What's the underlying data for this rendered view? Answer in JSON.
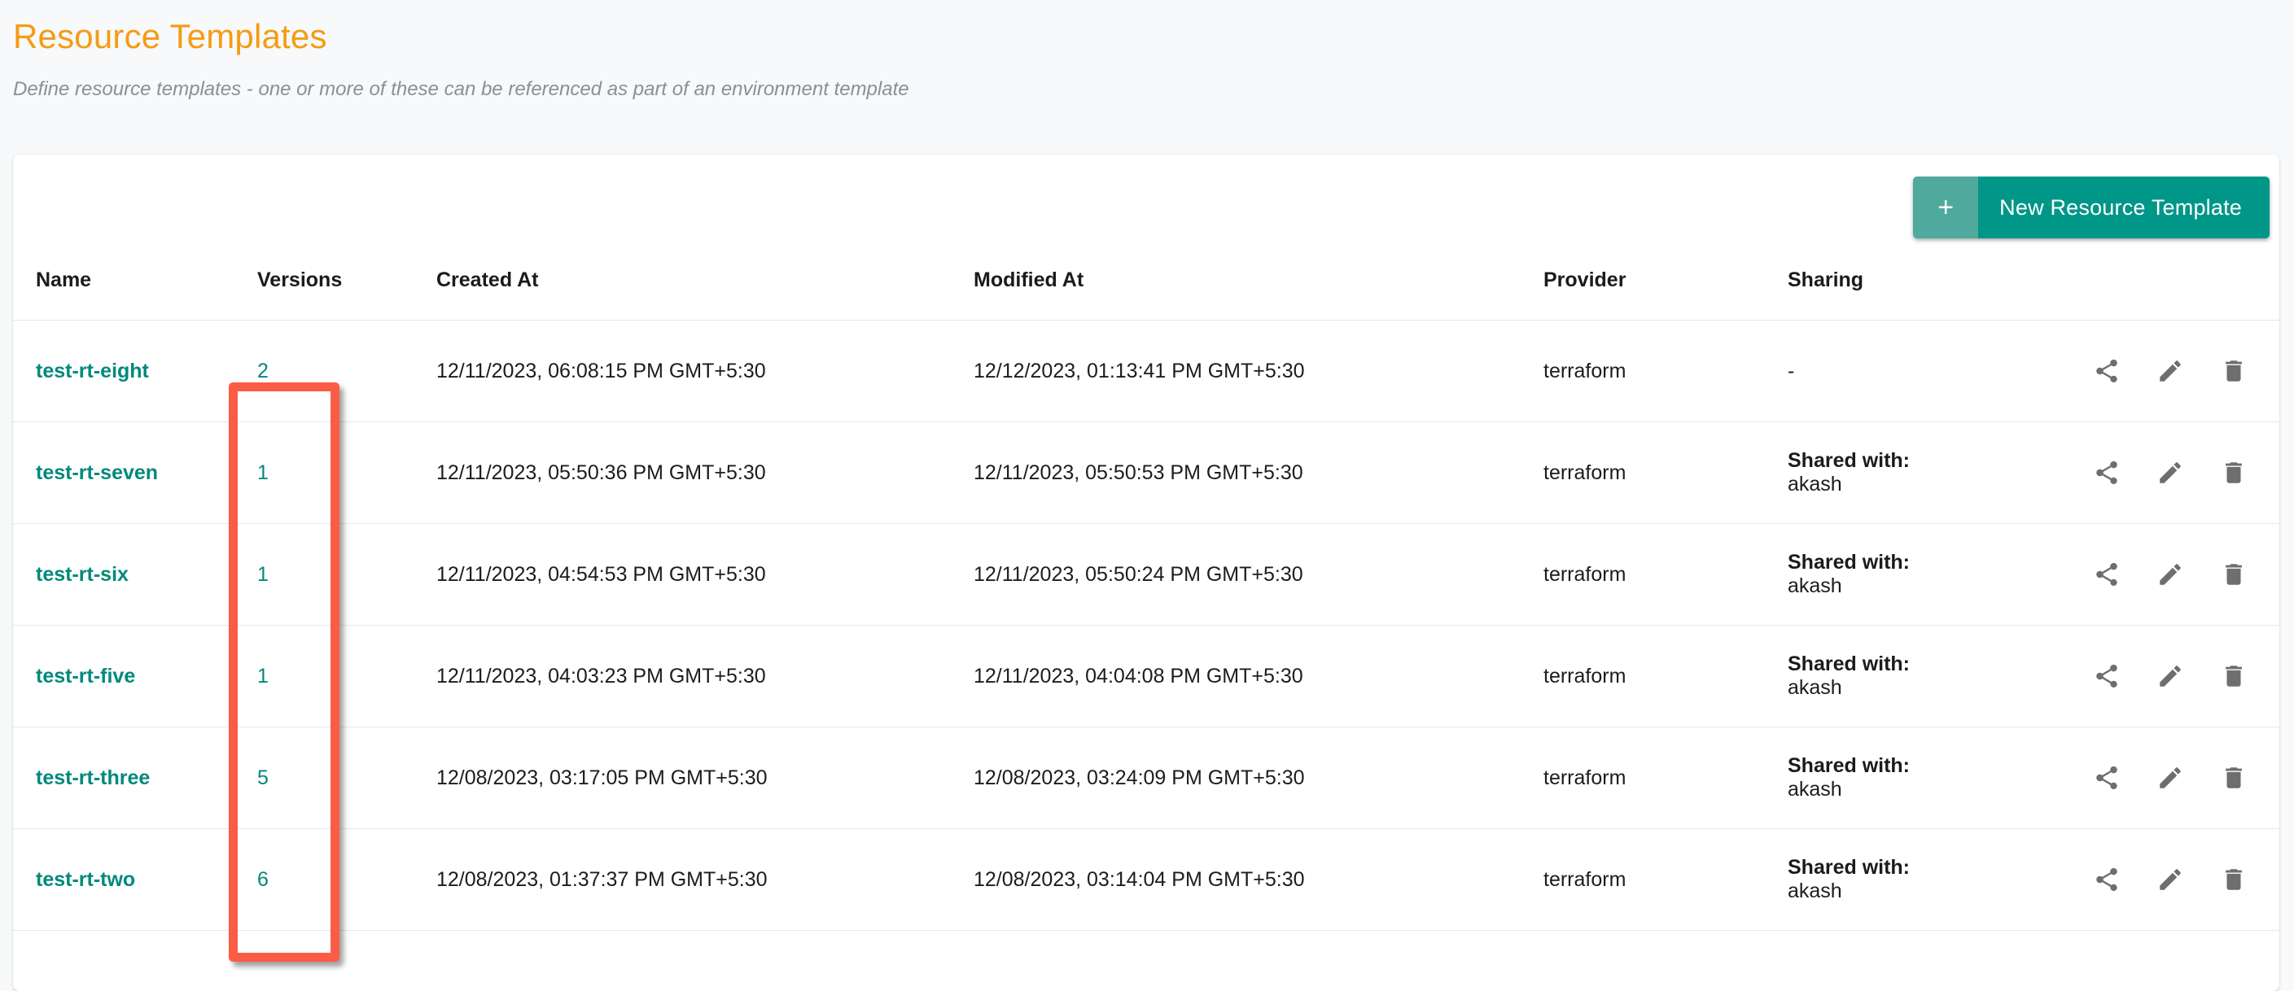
{
  "header": {
    "title": "Resource Templates",
    "subtitle": "Define resource templates - one or more of these can be referenced as part of an environment template",
    "title_color": "#f59b14"
  },
  "toolbar": {
    "new_button_plus": "+",
    "new_button_label": "New Resource Template",
    "new_button_color": "#009688",
    "new_button_plus_color": "#4faa9d"
  },
  "table": {
    "columns": [
      {
        "key": "name",
        "label": "Name"
      },
      {
        "key": "versions",
        "label": "Versions"
      },
      {
        "key": "created_at",
        "label": "Created At"
      },
      {
        "key": "modified_at",
        "label": "Modified At"
      },
      {
        "key": "provider",
        "label": "Provider"
      },
      {
        "key": "sharing",
        "label": "Sharing"
      },
      {
        "key": "actions",
        "label": ""
      }
    ],
    "link_color": "#00897b",
    "rows": [
      {
        "name": "test-rt-eight",
        "versions": "2",
        "created_at": "12/11/2023, 06:08:15 PM GMT+5:30",
        "modified_at": "12/12/2023, 01:13:41 PM GMT+5:30",
        "provider": "terraform",
        "sharing_label": "-",
        "sharing_user": ""
      },
      {
        "name": "test-rt-seven",
        "versions": "1",
        "created_at": "12/11/2023, 05:50:36 PM GMT+5:30",
        "modified_at": "12/11/2023, 05:50:53 PM GMT+5:30",
        "provider": "terraform",
        "sharing_label": "Shared with:",
        "sharing_user": "akash"
      },
      {
        "name": "test-rt-six",
        "versions": "1",
        "created_at": "12/11/2023, 04:54:53 PM GMT+5:30",
        "modified_at": "12/11/2023, 05:50:24 PM GMT+5:30",
        "provider": "terraform",
        "sharing_label": "Shared with:",
        "sharing_user": "akash"
      },
      {
        "name": "test-rt-five",
        "versions": "1",
        "created_at": "12/11/2023, 04:03:23 PM GMT+5:30",
        "modified_at": "12/11/2023, 04:04:08 PM GMT+5:30",
        "provider": "terraform",
        "sharing_label": "Shared with:",
        "sharing_user": "akash"
      },
      {
        "name": "test-rt-three",
        "versions": "5",
        "created_at": "12/08/2023, 03:17:05 PM GMT+5:30",
        "modified_at": "12/08/2023, 03:24:09 PM GMT+5:30",
        "provider": "terraform",
        "sharing_label": "Shared with:",
        "sharing_user": "akash"
      },
      {
        "name": "test-rt-two",
        "versions": "6",
        "created_at": "12/08/2023, 01:37:37 PM GMT+5:30",
        "modified_at": "12/08/2023, 03:14:04 PM GMT+5:30",
        "provider": "terraform",
        "sharing_label": "Shared with:",
        "sharing_user": "akash"
      }
    ],
    "row_actions": [
      {
        "icon": "share-icon",
        "name": "share-button"
      },
      {
        "icon": "edit-pencil-icon",
        "name": "edit-button"
      },
      {
        "icon": "trash-icon",
        "name": "delete-button"
      }
    ]
  },
  "annotation": {
    "target_column": "Versions",
    "color": "#fc5b45"
  }
}
